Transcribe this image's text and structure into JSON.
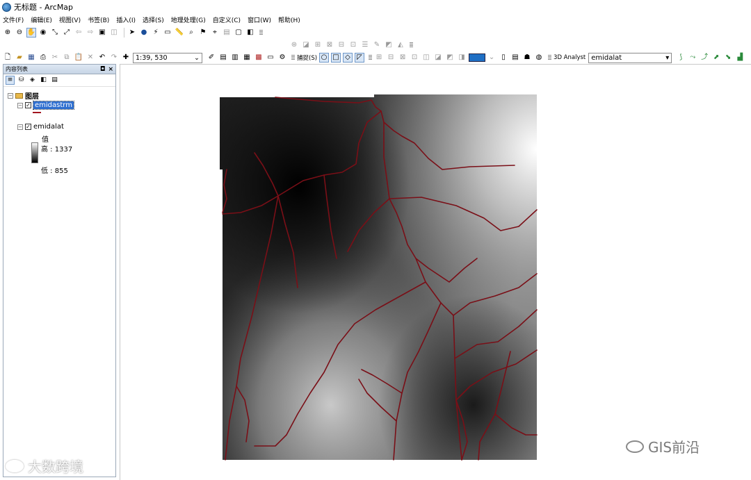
{
  "window": {
    "title": "无标题 - ArcMap"
  },
  "menu": [
    "文件(F)",
    "编辑(E)",
    "视图(V)",
    "书签(B)",
    "插入(I)",
    "选择(S)",
    "地理处理(G)",
    "自定义(C)",
    "窗口(W)",
    "帮助(H)"
  ],
  "toolbar": {
    "scale": "1:39, 530",
    "snap_label": "捕捉(S)",
    "analyst_label": "3D Analyst",
    "layer_combo": "emidalat"
  },
  "toc": {
    "title": "内容列表",
    "controls": {
      "pin": "◘",
      "close": "×"
    },
    "group_name": "图层",
    "layers": [
      {
        "name": "emidastrm",
        "checked": true,
        "selected": true
      },
      {
        "name": "emidalat",
        "checked": true,
        "selected": false
      }
    ],
    "legend": {
      "header": "值",
      "high": "高 : 1337",
      "low": "低 : 855"
    }
  },
  "watermarks": {
    "right": "GIS前沿",
    "left": "大数跨境"
  },
  "colors": {
    "stream": "#7a0f17",
    "selection": "#2f6fd0",
    "dem_high": "#ffffff",
    "dem_low": "#000000"
  }
}
